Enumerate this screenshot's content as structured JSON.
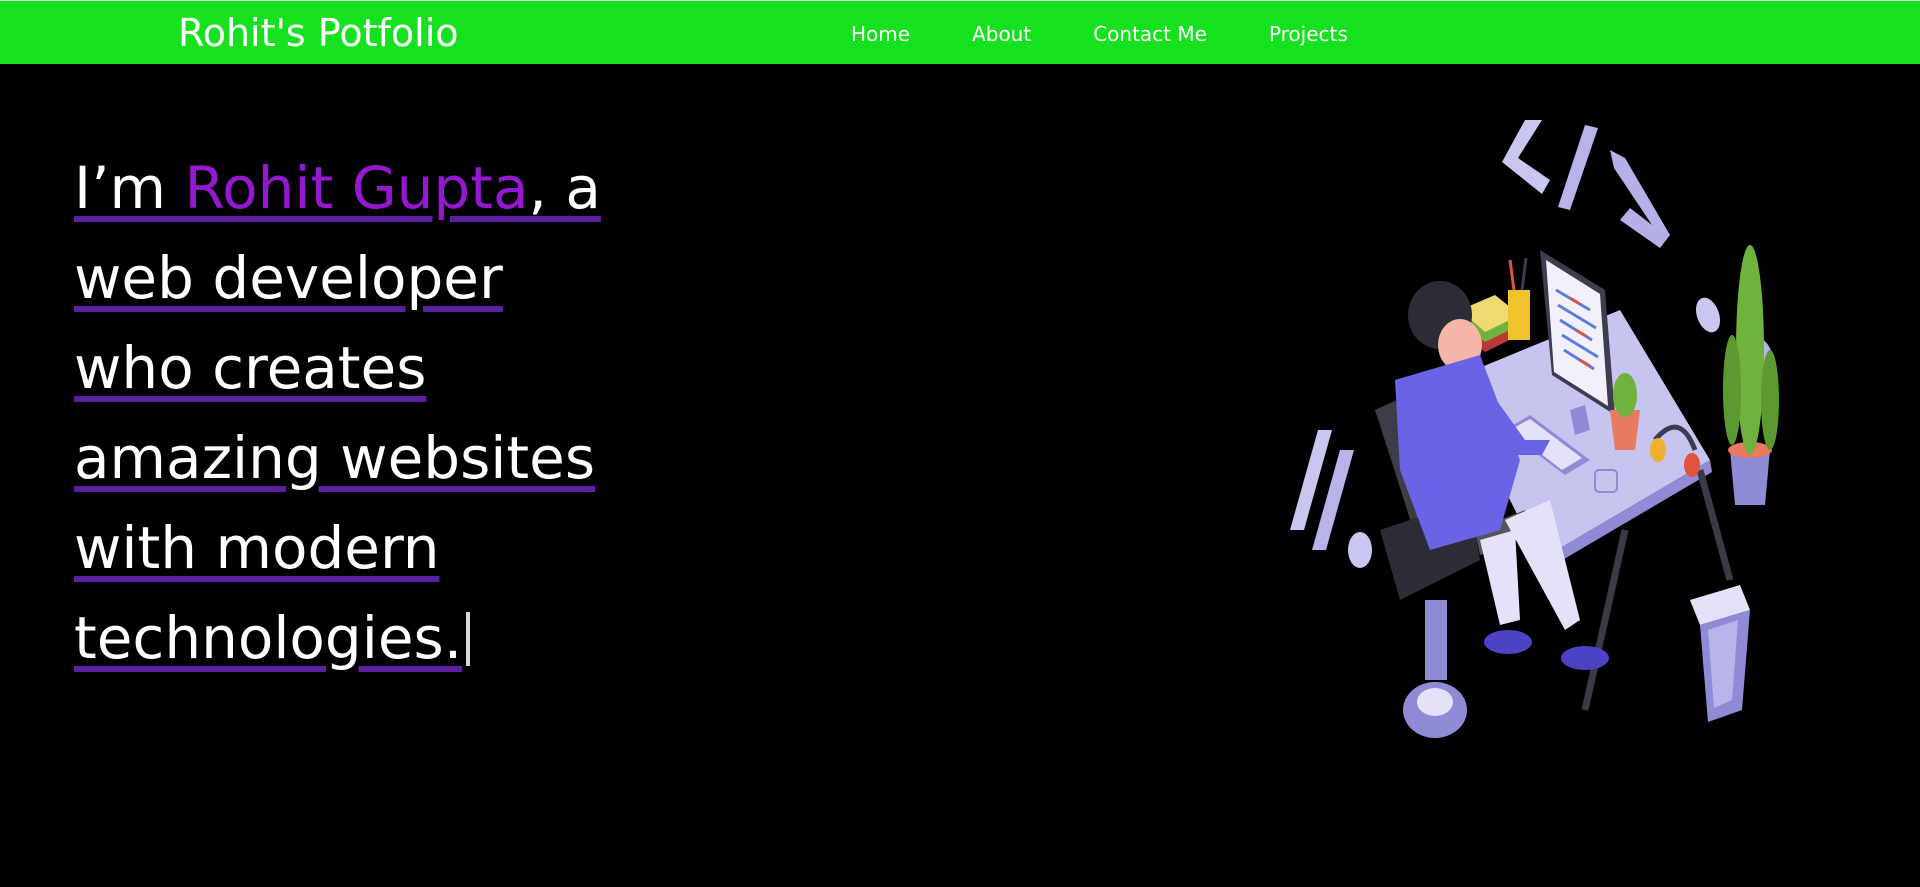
{
  "navbar": {
    "brand": "Rohit's Potfolio",
    "links": [
      "Home",
      "About",
      "Contact Me",
      "Projects"
    ],
    "background_color": "#16e11e"
  },
  "hero": {
    "prefix": "I’m ",
    "name": "Rohit Gupta",
    "suffix_line1": ", a",
    "line2": "web developer",
    "line3": "who creates",
    "line4": "amazing websites",
    "line5": "with modern",
    "line6": "technologies.",
    "name_color": "#9617d1",
    "underline_color": "#5b1fa0"
  },
  "illustration": {
    "icon": "developer-at-desk-illustration"
  }
}
